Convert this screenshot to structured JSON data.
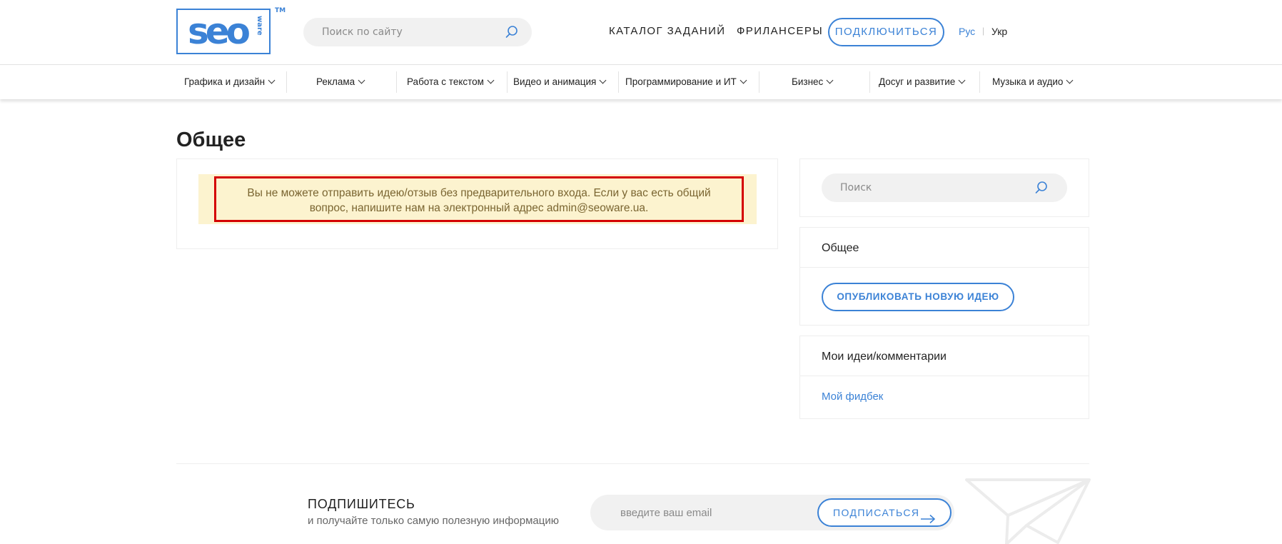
{
  "header": {
    "logo_text": "seo",
    "logo_suffix": "ware",
    "logo_tm": "TM",
    "search_placeholder": "Поиск по сайту",
    "nav_catalog": "КАТАЛОГ ЗАДАНИЙ",
    "nav_freelancers": "ФРИЛАНСЕРЫ",
    "connect_label": "ПОДКЛЮЧИТЬСЯ",
    "lang_ru": "Рус",
    "lang_sep": "|",
    "lang_ua": "Укр"
  },
  "categories": [
    "Графика и дизайн",
    "Реклама",
    "Работа с текстом",
    "Видео и анимация",
    "Программирование и ИТ",
    "Бизнес",
    "Досуг и развитие",
    "Музыка и аудио"
  ],
  "main": {
    "title": "Общее",
    "alert_line1": "Вы не можете отправить идею/отзыв без предварительного входа. Если у вас есть общий",
    "alert_line2": "вопрос, напишите нам на электронный адрес admin@seoware.ua."
  },
  "sidebar": {
    "search_placeholder": "Поиск",
    "general_heading": "Общее",
    "publish_label": "ОПУБЛИКОВАТЬ НОВУЮ ИДЕЮ",
    "my_heading": "Мои идеи/комментарии",
    "my_link": "Мой фидбек"
  },
  "footer": {
    "subscribe_title": "ПОДПИШИТЕСЬ",
    "subscribe_desc": "и получайте только самую полезную информацию",
    "email_placeholder": "введите ваш email",
    "subscribe_label": "ПОДПИСАТЬСЯ"
  },
  "colors": {
    "accent": "#3b82d6",
    "alert_bg": "#fcf3cf",
    "alert_border": "#d40000",
    "alert_text": "#7a6531"
  }
}
